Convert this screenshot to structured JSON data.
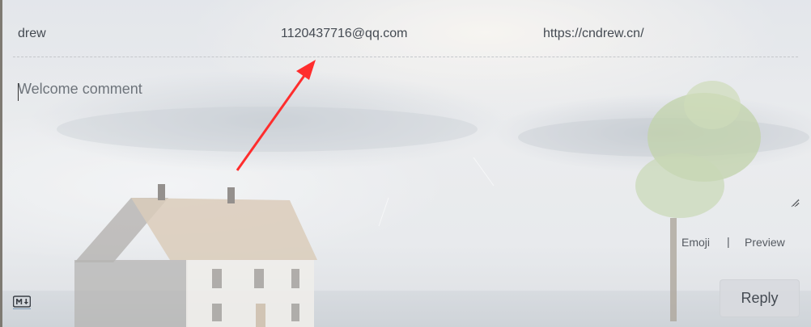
{
  "comment_form": {
    "nickname_value": "drew",
    "email_value": "1120437716@qq.com",
    "website_value": "https://cndrew.cn/",
    "editor_placeholder": "Welcome comment",
    "emoji_label": "Emoji",
    "separator": "|",
    "preview_label": "Preview",
    "reply_label": "Reply",
    "markdown_icon": "markdown-icon"
  },
  "annotation": {
    "type": "red-arrow",
    "color": "#ff2d2d"
  }
}
